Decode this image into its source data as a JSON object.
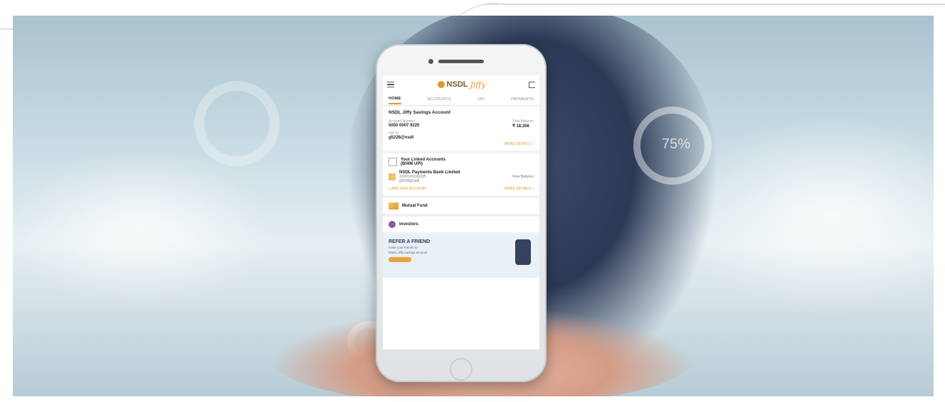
{
  "app": {
    "brand_name": "NSDL",
    "brand_accent": "Jiffy"
  },
  "tabs": [
    {
      "label": "HOME",
      "active": true
    },
    {
      "label": "ACCOUNTS",
      "active": false
    },
    {
      "label": "UPI",
      "active": false
    },
    {
      "label": "PAYMENTS",
      "active": false
    }
  ],
  "savings": {
    "title": "NSDL Jiffy Savings Account",
    "account_number_label": "Account Number",
    "account_number": "5050 0007 9225",
    "total_balance_label": "Total Balance",
    "total_balance": "₹ 18,356",
    "upi_label": "UPI Id",
    "upi_id": "g5228@nsdl",
    "more_details": "MORE DETAILS  »"
  },
  "linked": {
    "title": "Your Linked Accounts",
    "subtitle": "(BHIM UPI)",
    "bank_name": "NSDL Payments Bank Limited",
    "bank_account": "XXXXXXXX9225",
    "bank_upi": "g5228@nsdl",
    "view_balance": "View Balance",
    "add_account": "+ ADD NEW ACCOUNT",
    "more_details": "MORE DETAILS  »"
  },
  "mutual_fund": {
    "label": "Mutual Fund"
  },
  "investors": {
    "label": "Investors"
  },
  "refer": {
    "title": "REFER A FRIEND",
    "line1": "Invite your friends to",
    "line2": "NSDL Jiffy savings account"
  },
  "background": {
    "ring_label": "75%"
  },
  "colors": {
    "accent": "#e09a2c",
    "suit": "#2c3956"
  }
}
